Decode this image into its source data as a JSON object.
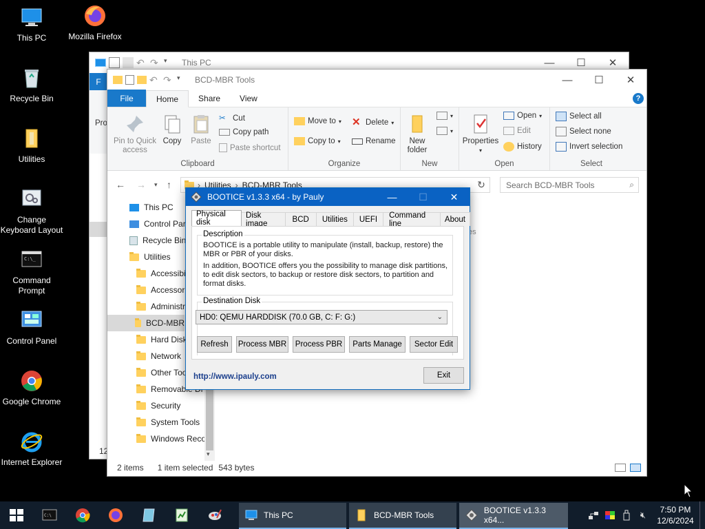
{
  "desktop": {
    "icons": [
      {
        "label": "This PC"
      },
      {
        "label": "Mozilla Firefox"
      },
      {
        "label": "Recycle Bin"
      },
      {
        "label": "Utilities"
      },
      {
        "label": "Change Keyboard Layout"
      },
      {
        "label": "Command Prompt"
      },
      {
        "label": "Control Panel"
      },
      {
        "label": "Google Chrome"
      },
      {
        "label": "Internet Explorer"
      }
    ]
  },
  "back_window": {
    "title": "This PC",
    "partial_tab": "F",
    "partial_label": "Pro",
    "partial_status": "12"
  },
  "explorer": {
    "title": "BCD-MBR Tools",
    "tabs": {
      "file": "File",
      "home": "Home",
      "share": "Share",
      "view": "View"
    },
    "help": "?",
    "ribbon": {
      "clipboard": {
        "group": "Clipboard",
        "pin": "Pin to Quick access",
        "copy": "Copy",
        "paste": "Paste",
        "cut": "Cut",
        "copy_path": "Copy path",
        "paste_shortcut": "Paste shortcut"
      },
      "organize": {
        "group": "Organize",
        "move_to": "Move to",
        "copy_to": "Copy to",
        "delete": "Delete",
        "rename": "Rename"
      },
      "new": {
        "group": "New",
        "new_folder": "New folder"
      },
      "open": {
        "group": "Open",
        "properties": "Properties",
        "open": "Open",
        "edit": "Edit",
        "history": "History"
      },
      "select": {
        "group": "Select",
        "select_all": "Select all",
        "select_none": "Select none",
        "invert": "Invert selection"
      }
    },
    "address": {
      "crumb1": "Utilities",
      "crumb2": "BCD-MBR Tools"
    },
    "search_placeholder": "Search BCD-MBR Tools",
    "nav": [
      {
        "label": "This PC"
      },
      {
        "label": "Control Par"
      },
      {
        "label": "Recycle Bin"
      },
      {
        "label": "Utilities"
      },
      {
        "label": "Accessibili"
      },
      {
        "label": "Accessorie"
      },
      {
        "label": "Administra"
      },
      {
        "label": "BCD-MBR"
      },
      {
        "label": "Hard Disk"
      },
      {
        "label": "Network"
      },
      {
        "label": "Other Too"
      },
      {
        "label": "Removable Di"
      },
      {
        "label": "Security"
      },
      {
        "label": "System Tools"
      },
      {
        "label": "Windows Reco"
      }
    ],
    "behind_text": "es",
    "status": {
      "items": "2 items",
      "selected": "1 item selected",
      "size": "543 bytes"
    }
  },
  "bootice": {
    "title": "BOOTICE v1.3.3 x64 - by Pauly",
    "tabs": [
      "Physical disk",
      "Disk image",
      "BCD",
      "Utilities",
      "UEFI",
      "Command line",
      "About"
    ],
    "description_legend": "Description",
    "description_p1": "BOOTICE is a portable utility to manipulate (install, backup, restore) the MBR or PBR of your disks.",
    "description_p2": "In addition, BOOTICE offers you the possibility to manage disk partitions, to edit disk sectors, to backup or restore disk sectors, to partition and format disks.",
    "dest_legend": "Destination Disk",
    "dest_value": "HD0: QEMU HARDDISK (70.0 GB, C: F: G:)",
    "buttons": {
      "refresh": "Refresh",
      "process_mbr": "Process MBR",
      "process_pbr": "Process PBR",
      "parts_manage": "Parts Manage",
      "sector_edit": "Sector Edit"
    },
    "link": "http://www.ipauly.com",
    "exit": "Exit"
  },
  "taskbar": {
    "tasks": [
      {
        "label": "This PC"
      },
      {
        "label": "BCD-MBR Tools"
      },
      {
        "label": "BOOTICE v1.3.3 x64..."
      }
    ],
    "time": "7:50 PM",
    "date": "12/6/2024"
  },
  "colors": {
    "accent": "#0a62c3",
    "file_tab": "#1979ca",
    "taskbar": "#111d2b"
  }
}
